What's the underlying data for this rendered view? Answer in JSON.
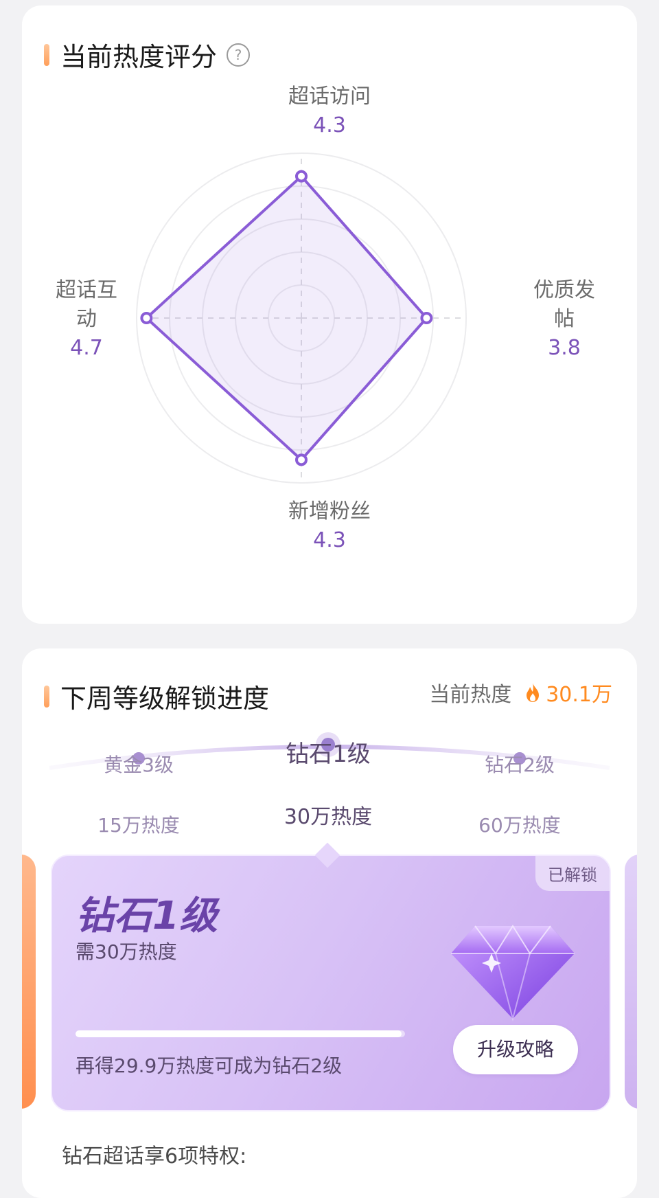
{
  "heat_score": {
    "title": "当前热度评分",
    "help_icon": "question-circle-icon",
    "axes": [
      {
        "name": "超话访问",
        "score": "4.3"
      },
      {
        "name": "优质发帖",
        "score": "3.8"
      },
      {
        "name": "新增粉丝",
        "score": "4.3"
      },
      {
        "name": "超话互动",
        "score": "4.7"
      }
    ],
    "right_label_lines": [
      "优质发",
      "帖"
    ],
    "left_label_lines": [
      "超话互",
      "动"
    ],
    "color": "#8a5cd6"
  },
  "unlock": {
    "title": "下周等级解锁进度",
    "current_heat_label": "当前热度",
    "current_heat_value": "30.1万",
    "flame_icon": "flame-icon",
    "levels": [
      {
        "name": "黄金3级",
        "req": "15万热度"
      },
      {
        "name": "钻石1级",
        "req": "30万热度"
      },
      {
        "name": "钻石2级",
        "req": "60万热度"
      }
    ],
    "card": {
      "tag": "已解锁",
      "title": "钻石1级",
      "need": "需30万热度",
      "progress": 0.99,
      "hint": "再得29.9万热度可成为钻石2级",
      "button": "升级攻略",
      "diamond_icon": "diamond-icon"
    },
    "privileges": "钻石超话享6项特权:"
  }
}
